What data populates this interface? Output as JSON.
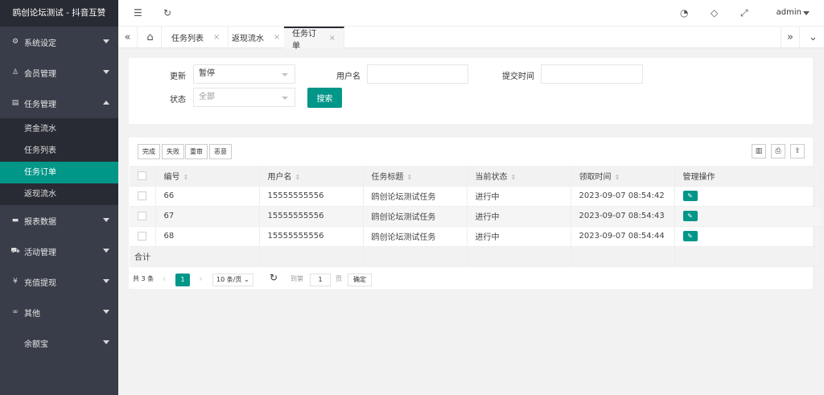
{
  "app": {
    "title": "鸥创论坛测试 - 抖音互赞"
  },
  "sidebar": {
    "items": [
      {
        "label": "系统设定",
        "icon": "gear-icon"
      },
      {
        "label": "会员管理",
        "icon": "user-icon"
      },
      {
        "label": "任务管理",
        "icon": "document-icon"
      },
      {
        "label": "报表数据",
        "icon": "chat-icon"
      },
      {
        "label": "活动管理",
        "icon": "car-icon"
      },
      {
        "label": "充值提现",
        "icon": "yen-icon"
      },
      {
        "label": "其他",
        "icon": "link-icon"
      },
      {
        "label": "余额宝",
        "icon": ""
      }
    ],
    "sub_items": [
      {
        "label": "资金流水"
      },
      {
        "label": "任务列表"
      },
      {
        "label": "任务订单"
      },
      {
        "label": "返现流水"
      }
    ]
  },
  "header": {
    "user": "admin"
  },
  "tabs": [
    {
      "label": "任务列表"
    },
    {
      "label": "返现流水"
    },
    {
      "label": "任务订单"
    }
  ],
  "search": {
    "update_label": "更新",
    "update_value": "暂停",
    "username_label": "用户名",
    "username_value": "",
    "time_label": "提交时间",
    "time_value": "",
    "status_label": "状态",
    "status_placeholder": "全部",
    "search_button": "搜索"
  },
  "toolbar": {
    "buttons": [
      "完成",
      "失败",
      "重审",
      "恶意"
    ]
  },
  "table": {
    "headers": [
      "编号",
      "用户名",
      "任务标题",
      "当前状态",
      "领取时间",
      "管理操作"
    ],
    "rows": [
      [
        "66",
        "15555555556",
        "鸥创论坛测试任务",
        "进行中",
        "2023-09-07 08:54:42"
      ],
      [
        "67",
        "15555555556",
        "鸥创论坛测试任务",
        "进行中",
        "2023-09-07 08:54:43"
      ],
      [
        "68",
        "15555555556",
        "鸥创论坛测试任务",
        "进行中",
        "2023-09-07 08:54:44"
      ]
    ],
    "total_label": "合计"
  },
  "pager": {
    "total": "共 3 条",
    "current": "1",
    "per_page": "10 条/页",
    "goto_label": "到第",
    "goto_value": "1",
    "page_unit": "页",
    "confirm": "确定"
  },
  "colors": {
    "accent": "#009688",
    "sidebar": "#393d49"
  }
}
